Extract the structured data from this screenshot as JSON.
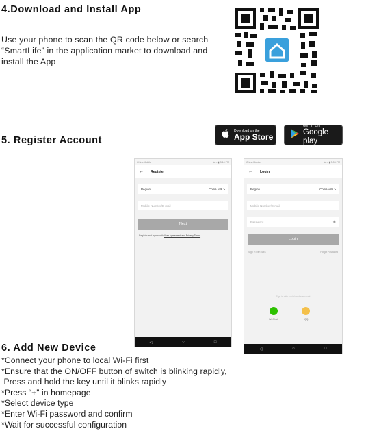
{
  "section4": {
    "heading": "4.Download and Install App",
    "intro": "Use your phone to scan the QR code below or search “SmartLife” in the application market to download and install the App"
  },
  "section5": {
    "heading": "5. Register Account",
    "app_store": {
      "small": "Download on the",
      "big": "App Store"
    },
    "google_play": {
      "small": "GET IT ON",
      "big": "Google play"
    }
  },
  "register_screen": {
    "carrier": "China Mobile",
    "status_right": "★ ≡ ▮ 3:14 PM",
    "title": "Register",
    "back": "←",
    "region_label": "Region",
    "region_value": "China +86  >",
    "mobile_placeholder": "Mobile Number/E-mail",
    "next_button": "Next",
    "agreement_prefix": "Register and agree with ",
    "agreement_link": "User Agreement and Privacy Terms"
  },
  "login_screen": {
    "carrier": "China Mobile",
    "status_right": "★ ≡ ▮ 3:03 PM",
    "title": "Login",
    "back": "←",
    "region_label": "Region",
    "region_value": "China +86  >",
    "mobile_placeholder": "Mobile Number/E-mail",
    "password_placeholder": "Password",
    "login_button": "Login",
    "sms_link": "Sign in with SMS",
    "forgot_link": "Forgot Password",
    "social_caption": "Sign in with social media account",
    "wechat": "WeChat",
    "qq": "QQ"
  },
  "nav_buttons": {
    "back": "◁",
    "home": "○",
    "recent": "□"
  },
  "section6": {
    "heading": "6. Add New Device",
    "steps": [
      "*Connect your phone to local Wi-Fi first",
      "*Ensure that the ON/OFF button of switch is blinking rapidly,",
      " Press and hold the key until it blinks rapidly",
      "*Press “+” in homepage",
      "*Select device type",
      "*Enter Wi-Fi password and confirm",
      "*Wait for successful configuration"
    ]
  },
  "colors": {
    "smartlife_blue": "#3aa0dc",
    "wechat_green": "#2dc100"
  }
}
